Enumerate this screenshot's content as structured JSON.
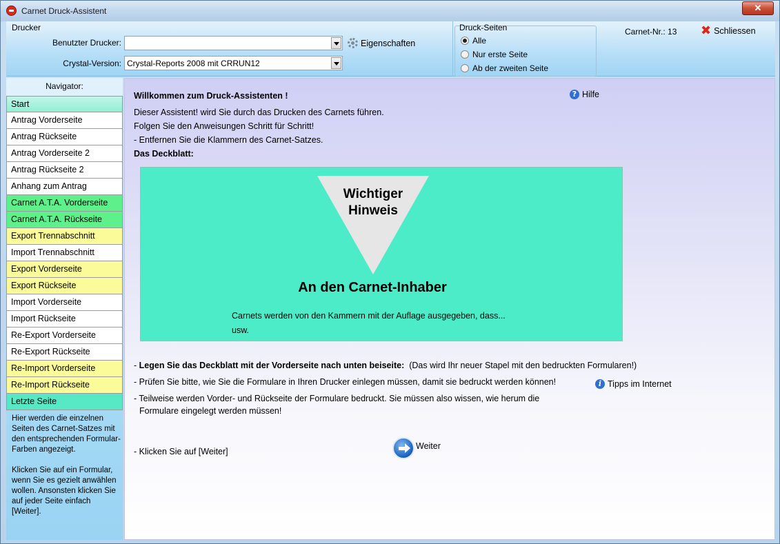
{
  "window": {
    "title": "Carnet Druck-Assistent",
    "close_label": "✕"
  },
  "drucker": {
    "group_label": "Drucker",
    "printer_label": "Benutzter Drucker:",
    "printer_value": "",
    "properties_label": "Eigenschaften",
    "crystal_label": "Crystal-Version:",
    "crystal_value": "Crystal-Reports 2008 mit CRRUN12"
  },
  "druck_seiten": {
    "group_label": "Druck-Seiten",
    "options": [
      {
        "label": "Alle",
        "checked": true
      },
      {
        "label": "Nur erste Seite",
        "checked": false
      },
      {
        "label": "Ab der zweiten Seite",
        "checked": false
      }
    ]
  },
  "carnet": {
    "label": "Carnet-Nr.:",
    "number": "13"
  },
  "close_button": {
    "label": "Schliessen"
  },
  "navigator": {
    "header": "Navigator:",
    "items": [
      {
        "label": "Start",
        "color": "start"
      },
      {
        "label": "Antrag Vorderseite",
        "color": "white"
      },
      {
        "label": "Antrag Rückseite",
        "color": "white"
      },
      {
        "label": "Antrag Vorderseite 2",
        "color": "white"
      },
      {
        "label": "Antrag Rückseite 2",
        "color": "white"
      },
      {
        "label": "Anhang zum Antrag",
        "color": "white"
      },
      {
        "label": "Carnet A.T.A. Vorderseite",
        "color": "green"
      },
      {
        "label": "Carnet A.T.A. Rückseite",
        "color": "green"
      },
      {
        "label": "Export Trennabschnitt",
        "color": "yellow"
      },
      {
        "label": "Import Trennabschnitt",
        "color": "white"
      },
      {
        "label": "Export Vorderseite",
        "color": "yellow"
      },
      {
        "label": "Export Rückseite",
        "color": "yellow"
      },
      {
        "label": "Import Vorderseite",
        "color": "white"
      },
      {
        "label": "Import Rückseite",
        "color": "white"
      },
      {
        "label": "Re-Export Vorderseite",
        "color": "white"
      },
      {
        "label": "Re-Export Rückseite",
        "color": "white"
      },
      {
        "label": "Re-Import Vorderseite",
        "color": "yellow"
      },
      {
        "label": "Re-Import Rückseite",
        "color": "yellow"
      },
      {
        "label": "Letzte Seite",
        "color": "teal"
      }
    ],
    "help_text_1": "Hier werden die einzelnen Seiten des Carnet-Satzes mit den entsprechenden Formular-Farben angezeigt.",
    "help_text_2": "Klicken Sie auf ein Formular, wenn Sie es gezielt anwählen wollen. Ansonsten klicken Sie auf jeder Seite einfach [Weiter]."
  },
  "content": {
    "welcome": "Willkommen zum Druck-Assistenten !",
    "help_link": "Hilfe",
    "intro_1": "Dieser Assistent! wird Sie durch das Drucken des Carnets führen.",
    "intro_2": "Folgen Sie den Anweisungen Schritt für Schritt!",
    "intro_3": "- Entfernen Sie die Klammern des Carnet-Satzes.",
    "deckblatt_heading": "Das Deckblatt:",
    "cover": {
      "triangle_line_1": "Wichtiger",
      "triangle_line_2": "Hinweis",
      "title": "An den Carnet-Inhaber",
      "line_1": "Carnets werden von den Kammern mit der Auflage ausgegeben, dass...",
      "line_2": "usw."
    },
    "step_1_prefix": "- ",
    "step_1_bold": "Legen Sie das Deckblatt mit der Vorderseite nach unten beiseite:",
    "step_1_rest": "(Das wird Ihr neuer Stapel mit den bedruckten Formularen!)",
    "step_2": "- Prüfen Sie bitte, wie Sie die Formulare in Ihren Drucker einlegen müssen, damit sie bedruckt werden können!",
    "tips_link": "Tipps im Internet",
    "step_3a": "- Teilweise werden Vorder- und Rückseite der Formulare bedruckt. Sie müssen also wissen, wie herum die",
    "step_3b": "Formulare eingelegt werden müssen!",
    "click_hint": "- Klicken Sie auf [Weiter]",
    "next_label": "Weiter"
  }
}
